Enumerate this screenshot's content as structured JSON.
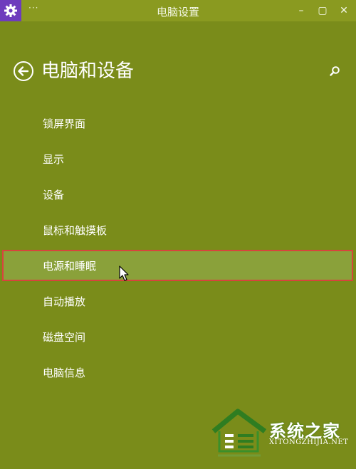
{
  "window": {
    "title": "电脑设置",
    "more_label": "···",
    "minimize_label": "–",
    "maximize_label": "▢",
    "close_label": "✕"
  },
  "header": {
    "title": "电脑和设备"
  },
  "menu": {
    "items": [
      {
        "label": "锁屏界面",
        "selected": false
      },
      {
        "label": "显示",
        "selected": false
      },
      {
        "label": "设备",
        "selected": false
      },
      {
        "label": "鼠标和触摸板",
        "selected": false
      },
      {
        "label": "电源和睡眠",
        "selected": true
      },
      {
        "label": "自动播放",
        "selected": false
      },
      {
        "label": "磁盘空间",
        "selected": false
      },
      {
        "label": "电脑信息",
        "selected": false
      }
    ]
  },
  "watermark": {
    "brand": "系统之家",
    "url": "XITONGZHIJIA.NET"
  },
  "colors": {
    "background": "#7a8c1a",
    "titlebar": "#8a9a20",
    "app_icon_bg": "#6e3bbd",
    "selection_bg": "#8aa13a",
    "selection_border": "#d8433d"
  },
  "icons": {
    "app": "gear-icon",
    "back": "back-arrow-icon",
    "search": "search-icon",
    "cursor": "mouse-cursor-icon",
    "watermark": "house-logo-icon"
  }
}
